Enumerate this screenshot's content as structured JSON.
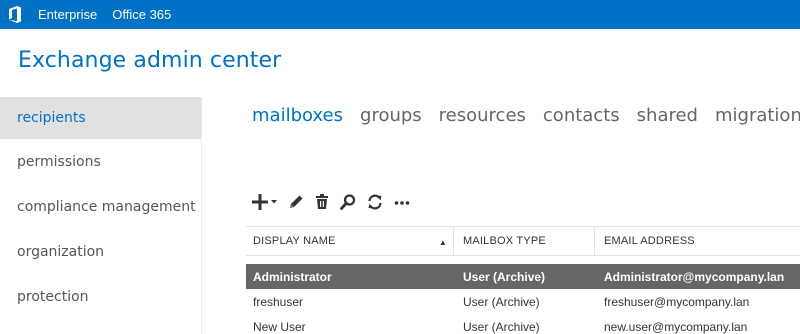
{
  "topbar": {
    "logo": "office-logo-icon",
    "links": [
      "Enterprise",
      "Office 365"
    ],
    "color": "#0072c6"
  },
  "app": {
    "title": "Exchange admin center"
  },
  "leftnav": {
    "items": [
      "recipients",
      "permissions",
      "compliance management",
      "organization",
      "protection"
    ],
    "active": "recipients"
  },
  "tabs": {
    "items": [
      "mailboxes",
      "groups",
      "resources",
      "contacts",
      "shared",
      "migration"
    ],
    "active": "mailboxes"
  },
  "toolbar": {
    "icons": [
      "add-dropdown-icon",
      "edit-icon",
      "delete-icon",
      "search-icon",
      "refresh-icon",
      "more-icon"
    ]
  },
  "table": {
    "columns": [
      "DISPLAY NAME",
      "MAILBOX TYPE",
      "EMAIL ADDRESS"
    ],
    "sort_column": "DISPLAY NAME",
    "sort_direction": "ascending",
    "rows": [
      {
        "name": "Administrator",
        "type": "User (Archive)",
        "email": "Administrator@mycompany.lan",
        "selected": true
      },
      {
        "name": "freshuser",
        "type": "User (Archive)",
        "email": "freshuser@mycompany.lan",
        "selected": false
      },
      {
        "name": "New User",
        "type": "User (Archive)",
        "email": "new.user@mycompany.lan",
        "selected": false
      }
    ]
  }
}
